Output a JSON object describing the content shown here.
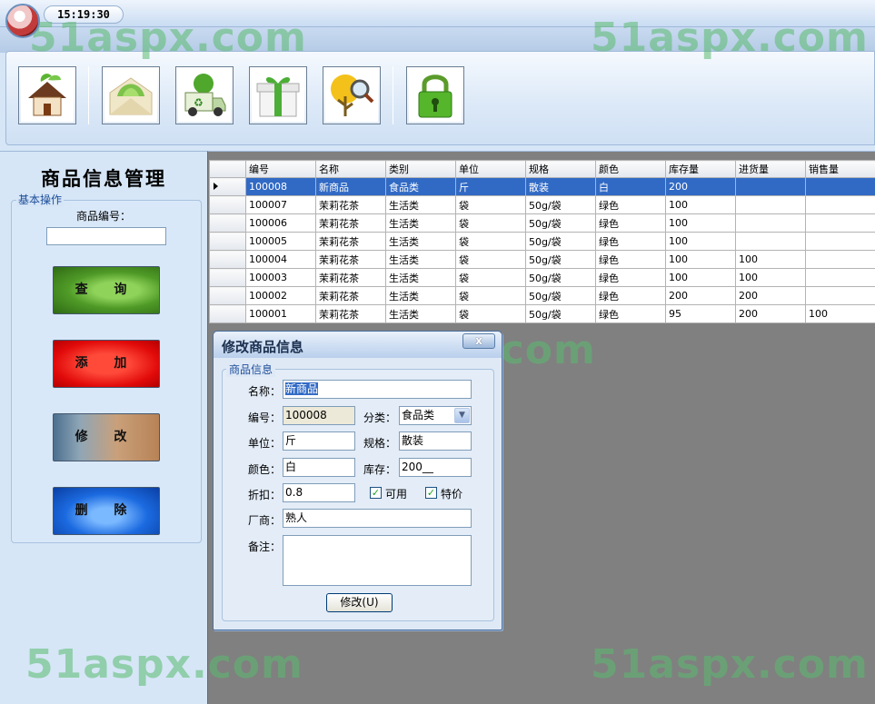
{
  "titlebar": {
    "clock": "15:19:30"
  },
  "toolbar": {
    "buttons": [
      {
        "name": "home-icon"
      },
      {
        "name": "mail-icon"
      },
      {
        "name": "recycle-truck-icon"
      },
      {
        "name": "gift-icon"
      },
      {
        "name": "search-icon"
      },
      {
        "name": "lock-icon"
      }
    ]
  },
  "left_panel": {
    "title": "商品信息管理",
    "group_label": "基本操作",
    "code_label": "商品编号：",
    "code_value": "",
    "buttons": {
      "query": "查 询",
      "add": "添 加",
      "edit": "修 改",
      "delete": "删 除"
    }
  },
  "grid": {
    "columns": [
      "编号",
      "名称",
      "类别",
      "单位",
      "规格",
      "颜色",
      "库存量",
      "进货量",
      "销售量"
    ],
    "rows": [
      [
        "100008",
        "新商品",
        "食品类",
        "斤",
        "散装",
        "白",
        "200",
        "",
        ""
      ],
      [
        "100007",
        "茉莉花茶",
        "生活类",
        "袋",
        "50g/袋",
        "绿色",
        "100",
        "",
        ""
      ],
      [
        "100006",
        "茉莉花茶",
        "生活类",
        "袋",
        "50g/袋",
        "绿色",
        "100",
        "",
        ""
      ],
      [
        "100005",
        "茉莉花茶",
        "生活类",
        "袋",
        "50g/袋",
        "绿色",
        "100",
        "",
        ""
      ],
      [
        "100004",
        "茉莉花茶",
        "生活类",
        "袋",
        "50g/袋",
        "绿色",
        "100",
        "100",
        ""
      ],
      [
        "100003",
        "茉莉花茶",
        "生活类",
        "袋",
        "50g/袋",
        "绿色",
        "100",
        "100",
        ""
      ],
      [
        "100002",
        "茉莉花茶",
        "生活类",
        "袋",
        "50g/袋",
        "绿色",
        "200",
        "200",
        ""
      ],
      [
        "100001",
        "茉莉花茶",
        "生活类",
        "袋",
        "50g/袋",
        "绿色",
        "95",
        "200",
        "100"
      ]
    ],
    "selected_row": 0
  },
  "dialog": {
    "title": "修改商品信息",
    "close_label": "x",
    "group_label": "商品信息",
    "fields": {
      "name_label": "名称：",
      "name_value": "新商品",
      "code_label": "编号：",
      "code_value": "100008",
      "category_label": "分类：",
      "category_value": "食品类",
      "unit_label": "单位：",
      "unit_value": "斤",
      "spec_label": "规格：",
      "spec_value": "散装",
      "color_label": "颜色：",
      "color_value": "白",
      "stock_label": "库存：",
      "stock_value": "200__",
      "discount_label": "折扣：",
      "discount_value": "0.8",
      "available_label": "可用",
      "available_checked": true,
      "special_label": "特价",
      "special_checked": true,
      "vendor_label": "厂商：",
      "vendor_value": "熟人",
      "remark_label": "备注：",
      "remark_value": ""
    },
    "submit_label": "修改(U)"
  },
  "watermark": "51aspx.com"
}
